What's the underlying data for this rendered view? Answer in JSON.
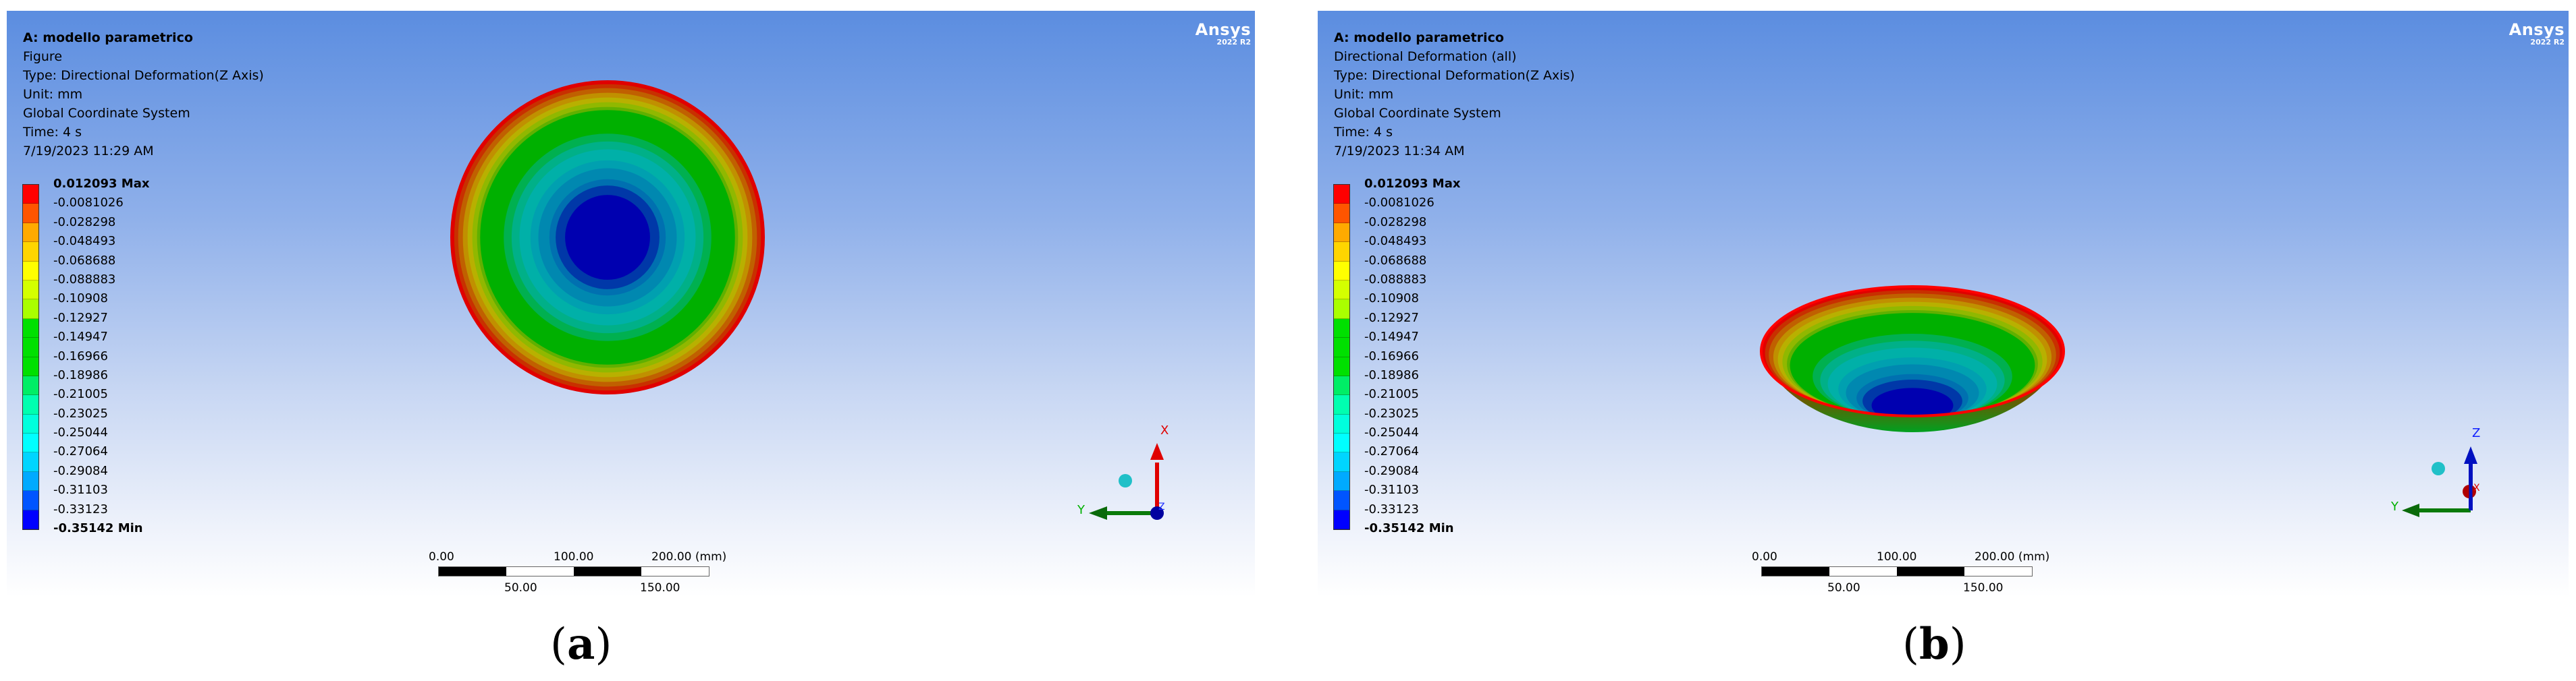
{
  "legend_values": [
    "0.012093 Max",
    "-0.0081026",
    "-0.028298",
    "-0.048493",
    "-0.068688",
    "-0.088883",
    "-0.10908",
    "-0.12927",
    "-0.14947",
    "-0.16966",
    "-0.18986",
    "-0.21005",
    "-0.23025",
    "-0.25044",
    "-0.27064",
    "-0.29084",
    "-0.31103",
    "-0.33123",
    "-0.35142 Min"
  ],
  "legend_colors": [
    "#ff0000",
    "#ff5500",
    "#ffaa00",
    "#ffd500",
    "#ffff00",
    "#d4ff00",
    "#aaff00",
    "#00e000",
    "#00e000",
    "#00e000",
    "#00ee66",
    "#00ffb0",
    "#00ffdd",
    "#00ffff",
    "#00d5ff",
    "#00aaff",
    "#0055ff",
    "#0000ff"
  ],
  "panels": {
    "a": {
      "title": "A: modello parametrico",
      "name": "Figure",
      "type": "Type: Directional Deformation(Z Axis)",
      "unit": "Unit: mm",
      "cs": "Global Coordinate System",
      "time": "Time: 4 s",
      "date": "7/19/2023 11:29 AM",
      "caption_open": "(",
      "caption_letter": "a",
      "caption_close": ")",
      "triad": {
        "up": "X",
        "left": "Y",
        "center": "Z"
      }
    },
    "b": {
      "title": "A: modello parametrico",
      "name": "Directional Deformation (all)",
      "type": "Type: Directional Deformation(Z Axis)",
      "unit": "Unit: mm",
      "cs": "Global Coordinate System",
      "time": "Time: 4 s",
      "date": "7/19/2023 11:34 AM",
      "caption_open": "(",
      "caption_letter": "b",
      "caption_close": ")",
      "triad": {
        "up": "Z",
        "left": "Y",
        "center": "X"
      }
    }
  },
  "logo": {
    "brand": "Ansys",
    "version": "2022 R2"
  },
  "scale": {
    "t0": "0.00",
    "t100": "100.00",
    "t200": "200.00 (mm)",
    "t50": "50.00",
    "t150": "150.00"
  },
  "contour_colors": [
    "#e00000",
    "#c83000",
    "#c06000",
    "#c09000",
    "#b8b000",
    "#90b800",
    "#60b000",
    "#00b000",
    "#00b050",
    "#00b088",
    "#00b0a8",
    "#00a0b0",
    "#0088b0",
    "#0070b0",
    "#0038a8",
    "#0000b0"
  ]
}
